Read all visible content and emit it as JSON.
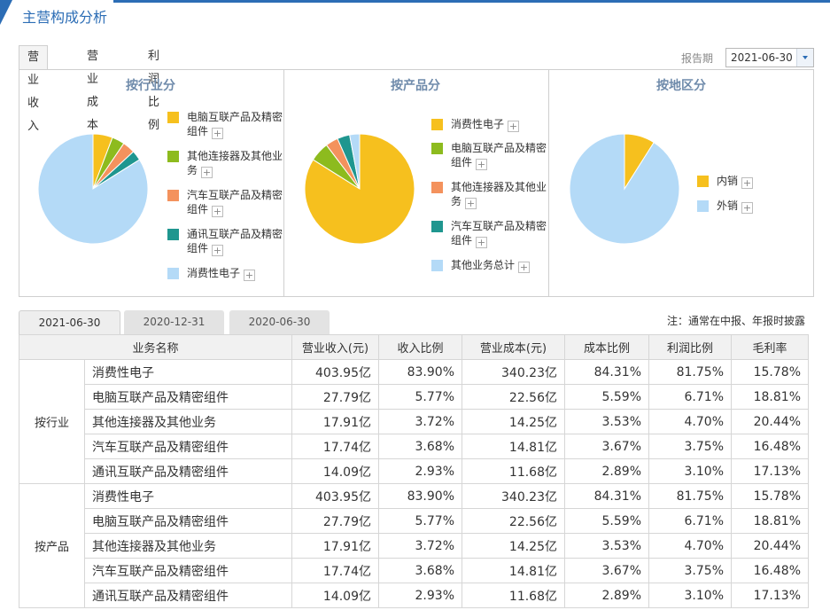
{
  "header": {
    "title": "主营构成分析"
  },
  "top_tabs": [
    "营业收入",
    "营业成本",
    "利润比例"
  ],
  "period": {
    "label": "报告期",
    "value": "2021-06-30"
  },
  "charts": [
    {
      "title": "按行业分",
      "legend": [
        "电脑互联产品及精密组件",
        "其他连接器及其他业务",
        "汽车互联产品及精密组件",
        "通讯互联产品及精密组件",
        "消费性电子"
      ]
    },
    {
      "title": "按产品分",
      "legend": [
        "消费性电子",
        "电脑互联产品及精密组件",
        "其他连接器及其他业务",
        "汽车互联产品及精密组件",
        "其他业务总计"
      ]
    },
    {
      "title": "按地区分",
      "legend": [
        "内销",
        "外销"
      ]
    }
  ],
  "chart_data": [
    {
      "type": "pie",
      "title": "按行业分",
      "labels": [
        "电脑互联产品及精密组件",
        "其他连接器及其他业务",
        "汽车互联产品及精密组件",
        "通讯互联产品及精密组件",
        "消费性电子"
      ],
      "values": [
        5.77,
        3.72,
        3.68,
        2.93,
        83.9
      ],
      "colors": [
        "#f6c01e",
        "#8dbb1e",
        "#f4925d",
        "#1f968f",
        "#b4daf7"
      ]
    },
    {
      "type": "pie",
      "title": "按产品分",
      "labels": [
        "消费性电子",
        "电脑互联产品及精密组件",
        "其他连接器及其他业务",
        "汽车互联产品及精密组件",
        "其他业务总计"
      ],
      "values": [
        83.9,
        5.77,
        3.72,
        3.68,
        2.93
      ],
      "colors": [
        "#f6c01e",
        "#8dbb1e",
        "#f4925d",
        "#1f968f",
        "#b4daf7"
      ]
    },
    {
      "type": "pie",
      "title": "按地区分",
      "labels": [
        "内销",
        "外销"
      ],
      "values": [
        9,
        91
      ],
      "colors": [
        "#f6c01e",
        "#b4daf7"
      ]
    }
  ],
  "bottom_tabs": [
    "2021-06-30",
    "2020-12-31",
    "2020-06-30"
  ],
  "note": "注：通常在中报、年报时披露",
  "table": {
    "headers": [
      "业务名称",
      "营业收入(元)",
      "收入比例",
      "营业成本(元)",
      "成本比例",
      "利润比例",
      "毛利率"
    ],
    "groups": [
      {
        "name": "按行业",
        "rows": [
          [
            "消费性电子",
            "403.95亿",
            "83.90%",
            "340.23亿",
            "84.31%",
            "81.75%",
            "15.78%"
          ],
          [
            "电脑互联产品及精密组件",
            "27.79亿",
            "5.77%",
            "22.56亿",
            "5.59%",
            "6.71%",
            "18.81%"
          ],
          [
            "其他连接器及其他业务",
            "17.91亿",
            "3.72%",
            "14.25亿",
            "3.53%",
            "4.70%",
            "20.44%"
          ],
          [
            "汽车互联产品及精密组件",
            "17.74亿",
            "3.68%",
            "14.81亿",
            "3.67%",
            "3.75%",
            "16.48%"
          ],
          [
            "通讯互联产品及精密组件",
            "14.09亿",
            "2.93%",
            "11.68亿",
            "2.89%",
            "3.10%",
            "17.13%"
          ]
        ]
      },
      {
        "name": "按产品",
        "rows": [
          [
            "消费性电子",
            "403.95亿",
            "83.90%",
            "340.23亿",
            "84.31%",
            "81.75%",
            "15.78%"
          ],
          [
            "电脑互联产品及精密组件",
            "27.79亿",
            "5.77%",
            "22.56亿",
            "5.59%",
            "6.71%",
            "18.81%"
          ],
          [
            "其他连接器及其他业务",
            "17.91亿",
            "3.72%",
            "14.25亿",
            "3.53%",
            "4.70%",
            "20.44%"
          ],
          [
            "汽车互联产品及精密组件",
            "17.74亿",
            "3.68%",
            "14.81亿",
            "3.67%",
            "3.75%",
            "16.48%"
          ],
          [
            "通讯互联产品及精密组件",
            "14.09亿",
            "2.93%",
            "11.68亿",
            "2.89%",
            "3.10%",
            "17.13%"
          ]
        ]
      }
    ]
  }
}
